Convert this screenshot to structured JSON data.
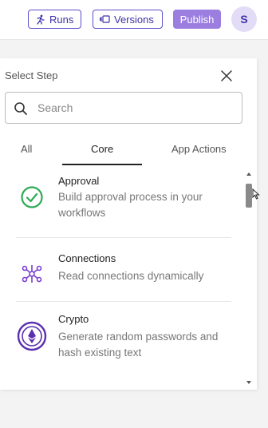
{
  "toolbar": {
    "runs_label": "Runs",
    "versions_label": "Versions",
    "publish_label": "Publish",
    "avatar_initial": "S"
  },
  "panel": {
    "title": "Select Step",
    "search": {
      "placeholder": "Search",
      "value": ""
    },
    "tabs": [
      {
        "label": "All",
        "active": false
      },
      {
        "label": "Core",
        "active": true
      },
      {
        "label": "App Actions",
        "active": false
      }
    ],
    "steps": [
      {
        "name": "Approval",
        "description": "Build approval process in your workflows",
        "icon": "check-circle-icon"
      },
      {
        "name": "Connections",
        "description": "Read connections dynamically",
        "icon": "network-nodes-icon"
      },
      {
        "name": "Crypto",
        "description": "Generate random passwords and hash existing text",
        "icon": "ethereum-icon"
      }
    ]
  },
  "colors": {
    "accent": "#5b4fc6",
    "publish": "#9b7ee0",
    "approval_green": "#2eaa57",
    "connections_purple": "#7b3fd0",
    "crypto_purple": "#5a2fb0"
  }
}
